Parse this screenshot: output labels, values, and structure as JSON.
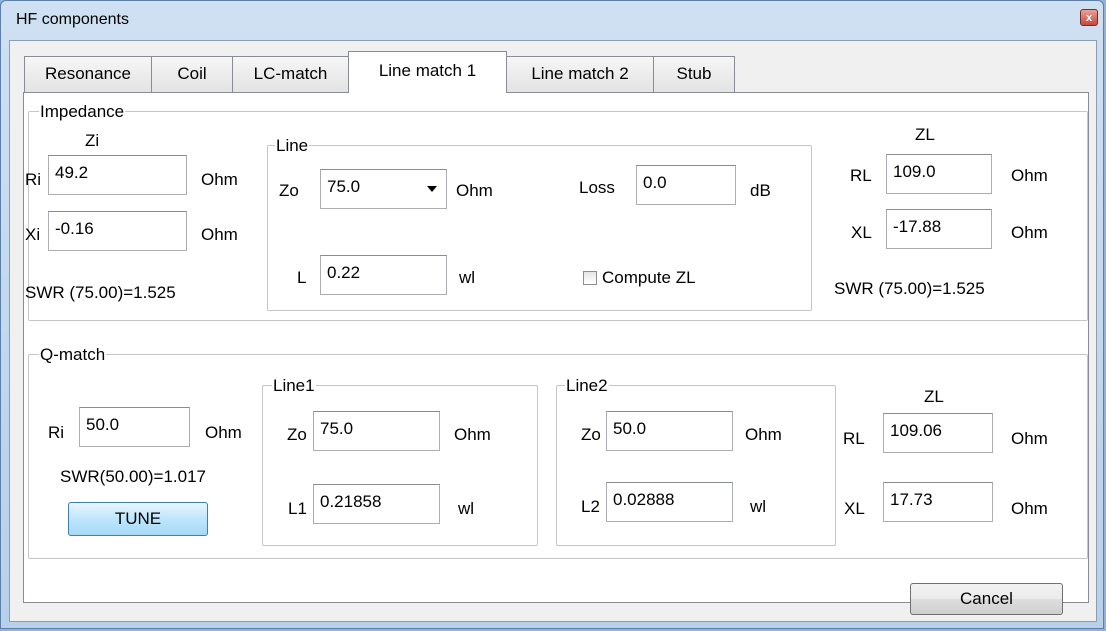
{
  "window": {
    "title": "HF components",
    "close_glyph": "x"
  },
  "tabs": [
    {
      "label": "Resonance"
    },
    {
      "label": "Coil"
    },
    {
      "label": "LC-match"
    },
    {
      "label": "Line match  1"
    },
    {
      "label": "Line match 2"
    },
    {
      "label": "Stub"
    }
  ],
  "active_tab": "Line match  1",
  "impedance": {
    "group_label": "Impedance",
    "zi": {
      "heading": "Zi",
      "ri_label": "Ri",
      "ri_value": "49.2",
      "ri_unit": "Ohm",
      "xi_label": "Xi",
      "xi_value": "-0.16",
      "xi_unit": "Ohm",
      "swr": "SWR (75.00)=1.525"
    },
    "line": {
      "group_label": "Line",
      "zo_label": "Zo",
      "zo_value": "75.0",
      "zo_unit": "Ohm",
      "loss_label": "Loss",
      "loss_value": "0.0",
      "loss_unit": "dB",
      "l_label": "L",
      "l_value": "0.22",
      "l_unit": "wl",
      "compute_label": "Compute ZL",
      "compute_checked": false
    },
    "zl": {
      "heading": "ZL",
      "rl_label": "RL",
      "rl_value": "109.0",
      "rl_unit": "Ohm",
      "xl_label": "XL",
      "xl_value": "-17.88",
      "xl_unit": "Ohm",
      "swr": "SWR (75.00)=1.525"
    }
  },
  "qmatch": {
    "group_label": "Q-match",
    "ri_label": "Ri",
    "ri_value": "50.0",
    "ri_unit": "Ohm",
    "swr": "SWR(50.00)=1.017",
    "tune_label": "TUNE",
    "line1": {
      "group_label": "Line1",
      "zo_label": "Zo",
      "zo_value": "75.0",
      "zo_unit": "Ohm",
      "l1_label": "L1",
      "l1_value": "0.21858",
      "l1_unit": "wl"
    },
    "line2": {
      "group_label": "Line2",
      "zo_label": "Zo",
      "zo_value": "50.0",
      "zo_unit": "Ohm",
      "l2_label": "L2",
      "l2_value": "0.02888",
      "l2_unit": "wl"
    },
    "zl": {
      "heading": "ZL",
      "rl_label": "RL",
      "rl_value": "109.06",
      "rl_unit": "Ohm",
      "xl_label": "XL",
      "xl_value": "17.73",
      "xl_unit": "Ohm"
    }
  },
  "footer": {
    "cancel_label": "Cancel"
  }
}
